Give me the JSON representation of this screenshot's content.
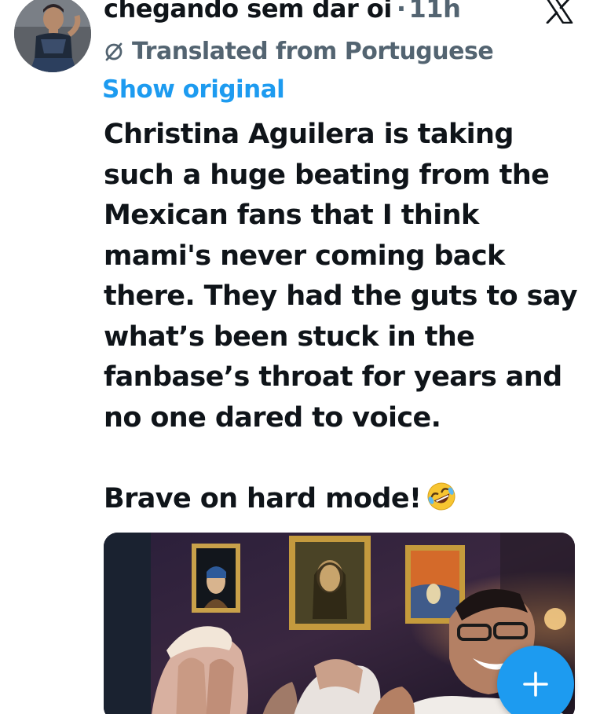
{
  "author": {
    "display_name": "chegando sem dar oi",
    "separator": "·",
    "timestamp": "11h"
  },
  "translation": {
    "notice": "Translated from Portuguese",
    "show_original_label": "Show original"
  },
  "tweet": {
    "lines_paragraph_1": [
      "Christina Aguilera is taking",
      "such a huge beating from the",
      "Mexican fans that I think",
      "mami's never coming back",
      "there. They had the guts to say",
      "what’s been stuck in the",
      "fanbase’s throat for years and",
      "no one dared to voice."
    ],
    "paragraph_2": "Brave on hard mode!",
    "emoji": "rolling-on-floor-laughing-emoji"
  },
  "icons": {
    "close": "x-logo-icon",
    "translate": "globe-slash-icon",
    "compose": "plus-icon"
  },
  "colors": {
    "accent": "#1d9bf0",
    "secondary_text": "#536471",
    "primary_text": "#0f1419"
  }
}
